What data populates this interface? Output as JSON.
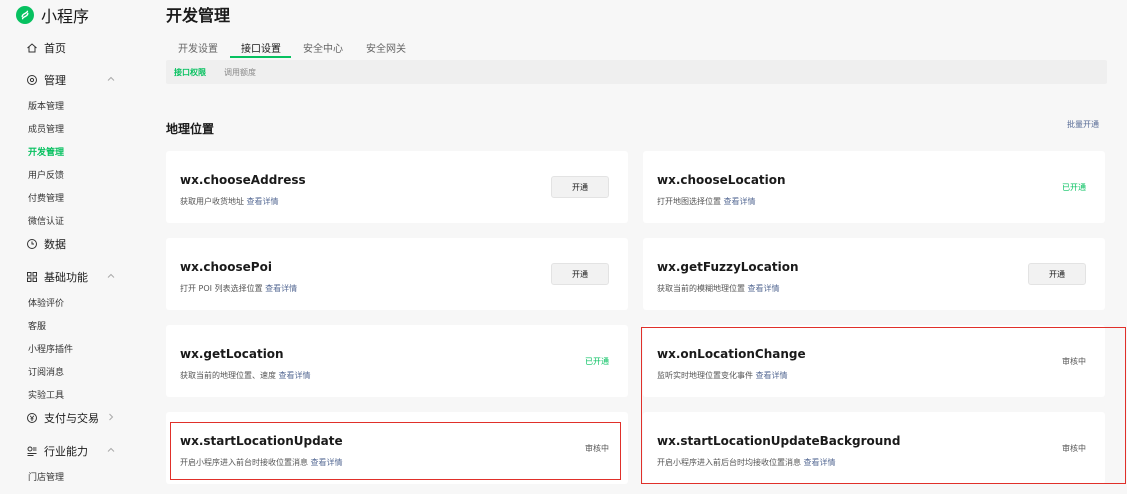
{
  "app": {
    "name": "小程序"
  },
  "sidebar": {
    "home": "首页",
    "manage": {
      "label": "管理",
      "items": [
        "版本管理",
        "成员管理",
        "开发管理",
        "用户反馈",
        "付费管理",
        "微信认证"
      ]
    },
    "data": "数据",
    "basic": {
      "label": "基础功能",
      "items": [
        "体验评价",
        "客服",
        "小程序插件",
        "订阅消息",
        "实验工具"
      ]
    },
    "payment": "支付与交易",
    "industry": {
      "label": "行业能力",
      "items": [
        "门店管理"
      ]
    }
  },
  "page": {
    "title": "开发管理"
  },
  "tabs": [
    "开发设置",
    "接口设置",
    "安全中心",
    "安全网关"
  ],
  "subtabs": [
    "接口权限",
    "调用额度"
  ],
  "section": {
    "title": "地理位置",
    "batch_link": "批量开通"
  },
  "cards": [
    {
      "name": "wx.chooseAddress",
      "desc": "获取用户收货地址",
      "detail": "查看详情",
      "action": "开通"
    },
    {
      "name": "wx.chooseLocation",
      "desc": "打开地图选择位置",
      "detail": "查看详情",
      "status": "已开通"
    },
    {
      "name": "wx.choosePoi",
      "desc": "打开 POI 列表选择位置",
      "detail": "查看详情",
      "action": "开通"
    },
    {
      "name": "wx.getFuzzyLocation",
      "desc": "获取当前的模糊地理位置",
      "detail": "查看详情",
      "action": "开通"
    },
    {
      "name": "wx.getLocation",
      "desc": "获取当前的地理位置、速度",
      "detail": "查看详情",
      "status": "已开通"
    },
    {
      "name": "wx.onLocationChange",
      "desc": "监听实时地理位置变化事件",
      "detail": "查看详情",
      "status": "审核中"
    },
    {
      "name": "wx.startLocationUpdate",
      "desc": "开启小程序进入前台时接收位置消息",
      "detail": "查看详情",
      "status": "审核中"
    },
    {
      "name": "wx.startLocationUpdateBackground",
      "desc": "开启小程序进入前后台时均接收位置消息",
      "detail": "查看详情",
      "status": "审核中"
    }
  ],
  "colors": {
    "accent": "#07c160",
    "link": "#576b95",
    "highlight": "#e0302a"
  }
}
